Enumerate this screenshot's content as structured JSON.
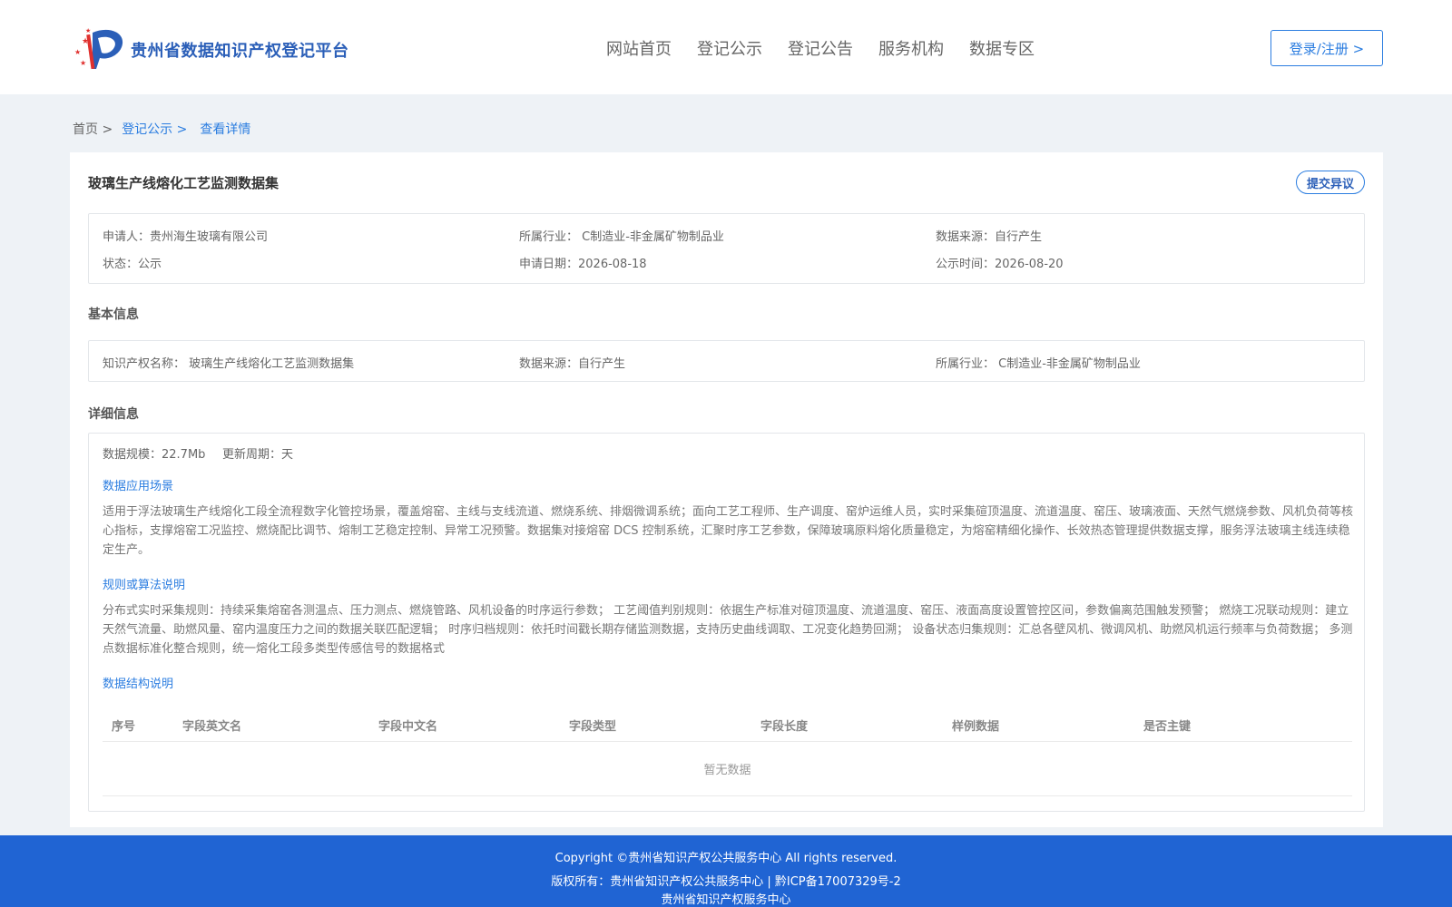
{
  "header": {
    "site_title": "贵州省数据知识产权登记平台",
    "nav": [
      "网站首页",
      "登记公示",
      "登记公告",
      "服务机构",
      "数据专区"
    ],
    "login": "登录/注册 >"
  },
  "breadcrumb": {
    "home": "首页 >",
    "link": "登记公示 >",
    "current": "查看详情"
  },
  "detail": {
    "title": "玻璃生产线熔化工艺监测数据集",
    "objection_button": "提交异议",
    "summary": {
      "applicant": "申请人：贵州海生玻璃有限公司",
      "industry": "所属行业： C制造业-非金属矿物制品业",
      "source": "数据来源：自行产生",
      "status": "状态：公示",
      "apply_date": "申请日期：2026-08-18",
      "publish_date": "公示时间：2026-08-20"
    },
    "basic": {
      "heading": "基本信息",
      "ip_name": "知识产权名称： 玻璃生产线熔化工艺监测数据集",
      "source": "数据来源：自行产生",
      "industry": "所属行业： C制造业-非金属矿物制品业"
    },
    "more": {
      "heading": "详细信息",
      "scale": "数据规模：22.7Mb",
      "cycle": "更新周期：天",
      "scene_title": "数据应用场景",
      "scene_text": "适用于浮法玻璃生产线熔化工段全流程数字化管控场景，覆盖熔窑、主线与支线流道、燃烧系统、排烟微调系统；面向工艺工程师、生产调度、窑炉运维人员，实时采集碹顶温度、流道温度、窑压、玻璃液面、天然气燃烧参数、风机负荷等核心指标，支撑熔窑工况监控、燃烧配比调节、熔制工艺稳定控制、异常工况预警。数据集对接熔窑 DCS 控制系统，汇聚时序工艺参数，保障玻璃原料熔化质量稳定，为熔窑精细化操作、长效热态管理提供数据支撑，服务浮法玻璃主线连续稳定生产。",
      "rule_title": "规则或算法说明",
      "rule_text": "分布式实时采集规则：持续采集熔窑各测温点、压力测点、燃烧管路、风机设备的时序运行参数； 工艺阈值判别规则：依据生产标准对碹顶温度、流道温度、窑压、液面高度设置管控区间，参数偏离范围触发预警； 燃烧工况联动规则：建立天然气流量、助燃风量、窑内温度压力之间的数据关联匹配逻辑； 时序归档规则：依托时间戳长期存储监测数据，支持历史曲线调取、工况变化趋势回溯； 设备状态归集规则：汇总各壁风机、微调风机、助燃风机运行频率与负荷数据； 多测点数据标准化整合规则，统一熔化工段多类型传感信号的数据格式",
      "struct_title": "数据结构说明",
      "table_headers": [
        "序号",
        "字段英文名",
        "字段中文名",
        "字段类型",
        "字段长度",
        "样例数据",
        "是否主键"
      ],
      "empty": "暂无数据"
    }
  },
  "footer": {
    "copyright": "Copyright ©贵州省知识产权公共服务中心 All rights reserved.",
    "rights": "版权所有：贵州省知识产权公共服务中心 | 黔ICP备17007329号-2",
    "org": "贵州省知识产权服务中心"
  },
  "colors": {
    "accent": "#2b7de0",
    "brand": "#2b5fb8",
    "footer": "#2064d3"
  }
}
